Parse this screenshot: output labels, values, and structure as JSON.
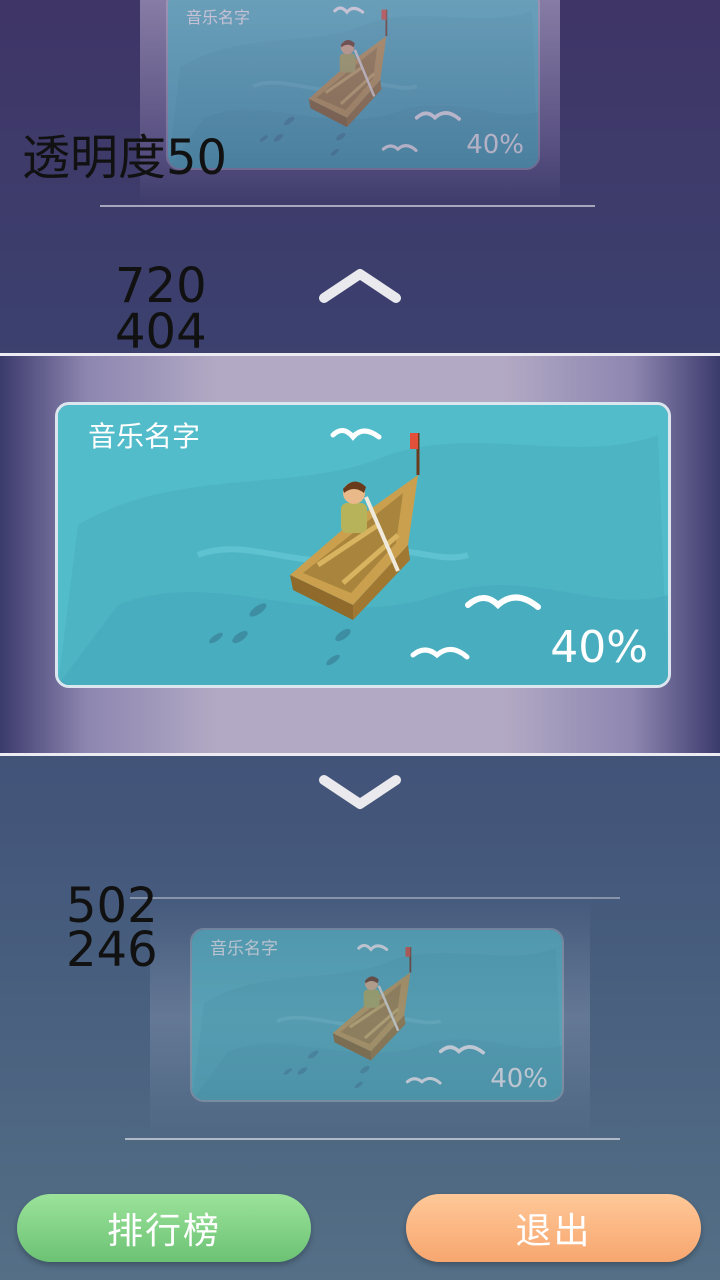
{
  "debug": {
    "alpha_label": "透明度50",
    "selected_size": {
      "w": "720",
      "h": "404"
    },
    "small_size": {
      "w": "502",
      "h": "246"
    }
  },
  "cards": {
    "top": {
      "title": "音乐名字",
      "percent": "40%"
    },
    "center": {
      "title": "音乐名字",
      "percent": "40%"
    },
    "bottom": {
      "title": "音乐名字",
      "percent": "40%"
    }
  },
  "nav": {
    "up_icon": "chevron-up-icon",
    "down_icon": "chevron-down-icon"
  },
  "buttons": {
    "leaderboard": "排行榜",
    "exit": "退出"
  },
  "colors": {
    "sea": "#4fb8c8",
    "leaderboard": "#7fd083",
    "exit": "#fcb682"
  }
}
